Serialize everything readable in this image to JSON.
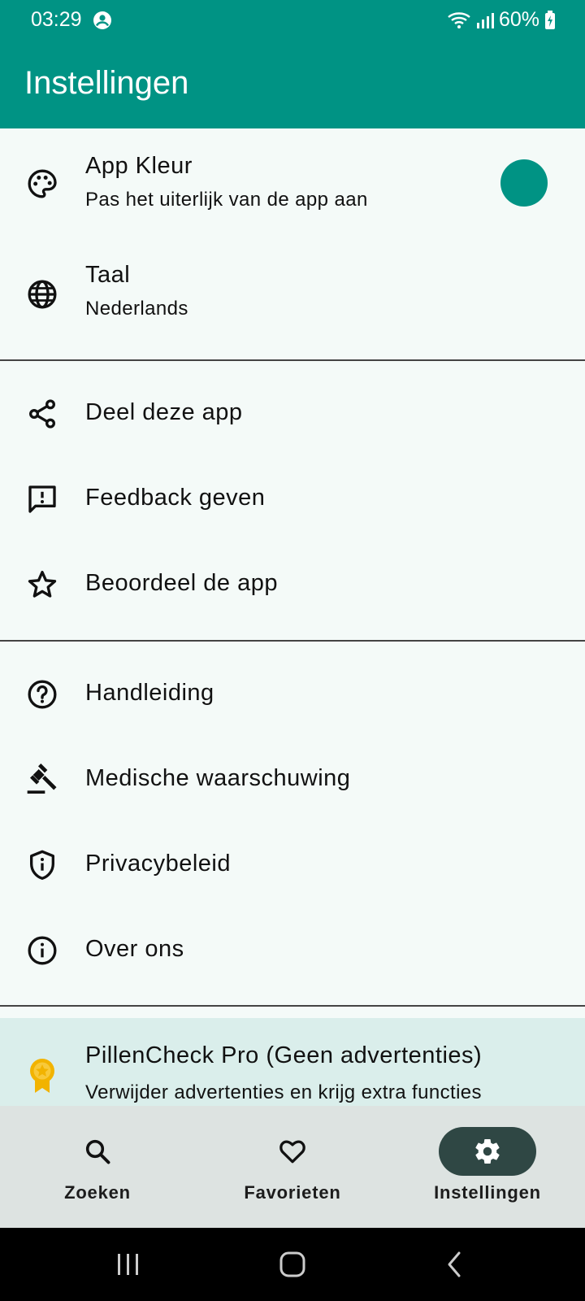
{
  "status": {
    "time": "03:29",
    "battery": "60%"
  },
  "appbar": {
    "title": "Instellingen"
  },
  "settings": {
    "app_color": {
      "title": "App Kleur",
      "subtitle": "Pas het uiterlijk van de app aan",
      "color": "#009384"
    },
    "language": {
      "title": "Taal",
      "subtitle": "Nederlands"
    },
    "share": {
      "title": "Deel deze app"
    },
    "feedback": {
      "title": "Feedback geven"
    },
    "rate": {
      "title": "Beoordeel de app"
    },
    "manual": {
      "title": "Handleiding"
    },
    "medical": {
      "title": "Medische waarschuwing"
    },
    "privacy": {
      "title": "Privacybeleid"
    },
    "about": {
      "title": "Over ons"
    },
    "pro": {
      "title": "PillenCheck Pro (Geen advertenties)",
      "subtitle": "Verwijder advertenties en krijg extra functies"
    }
  },
  "nav": {
    "items": [
      {
        "label": "Zoeken",
        "icon": "search-icon"
      },
      {
        "label": "Favorieten",
        "icon": "heart-icon"
      },
      {
        "label": "Instellingen",
        "icon": "gear-icon",
        "active": true
      }
    ]
  }
}
